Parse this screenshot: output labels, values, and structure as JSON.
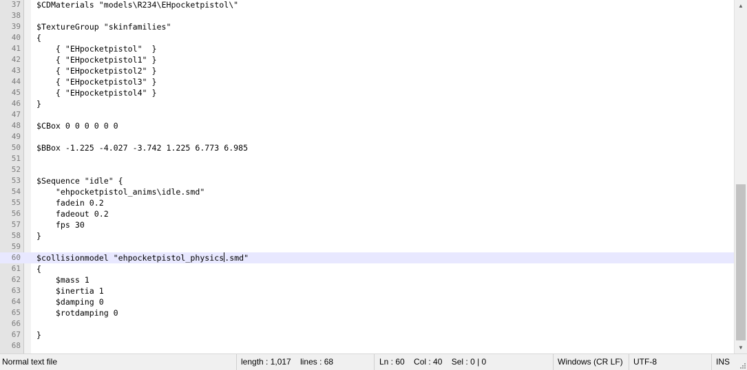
{
  "editor": {
    "current_line": 60,
    "lines": [
      {
        "n": "37",
        "text": "$CDMaterials \"models\\R234\\EHpocketpistol\\\""
      },
      {
        "n": "38",
        "text": ""
      },
      {
        "n": "39",
        "text": "$TextureGroup \"skinfamilies\""
      },
      {
        "n": "40",
        "text": "{"
      },
      {
        "n": "41",
        "text": "    { \"EHpocketpistol\"  }"
      },
      {
        "n": "42",
        "text": "    { \"EHpocketpistol1\" }"
      },
      {
        "n": "43",
        "text": "    { \"EHpocketpistol2\" }"
      },
      {
        "n": "44",
        "text": "    { \"EHpocketpistol3\" }"
      },
      {
        "n": "45",
        "text": "    { \"EHpocketpistol4\" }"
      },
      {
        "n": "46",
        "text": "}"
      },
      {
        "n": "47",
        "text": ""
      },
      {
        "n": "48",
        "text": "$CBox 0 0 0 0 0 0"
      },
      {
        "n": "49",
        "text": ""
      },
      {
        "n": "50",
        "text": "$BBox -1.225 -4.027 -3.742 1.225 6.773 6.985"
      },
      {
        "n": "51",
        "text": ""
      },
      {
        "n": "52",
        "text": ""
      },
      {
        "n": "53",
        "text": "$Sequence \"idle\" {"
      },
      {
        "n": "54",
        "text": "    \"ehpocketpistol_anims\\idle.smd\""
      },
      {
        "n": "55",
        "text": "    fadein 0.2"
      },
      {
        "n": "56",
        "text": "    fadeout 0.2"
      },
      {
        "n": "57",
        "text": "    fps 30"
      },
      {
        "n": "58",
        "text": "}"
      },
      {
        "n": "59",
        "text": ""
      },
      {
        "n": "60",
        "text": "$collisionmodel \"ehpocketpistol_physics.smd\"",
        "caret_col": 40
      },
      {
        "n": "61",
        "text": "{"
      },
      {
        "n": "62",
        "text": "    $mass 1"
      },
      {
        "n": "63",
        "text": "    $inertia 1"
      },
      {
        "n": "64",
        "text": "    $damping 0"
      },
      {
        "n": "65",
        "text": "    $rotdamping 0"
      },
      {
        "n": "66",
        "text": ""
      },
      {
        "n": "67",
        "text": "}"
      },
      {
        "n": "68",
        "text": ""
      }
    ]
  },
  "scrollbar": {
    "up_arrow_icon": "up-arrow-icon",
    "down_arrow_icon": "down-arrow-icon"
  },
  "statusbar": {
    "file_type": "Normal text file",
    "length": "length : 1,017",
    "lines": "lines : 68",
    "ln": "Ln : 60",
    "col": "Col : 40",
    "sel": "Sel : 0 | 0",
    "eol": "Windows (CR LF)",
    "encoding": "UTF-8",
    "mode": "INS"
  }
}
